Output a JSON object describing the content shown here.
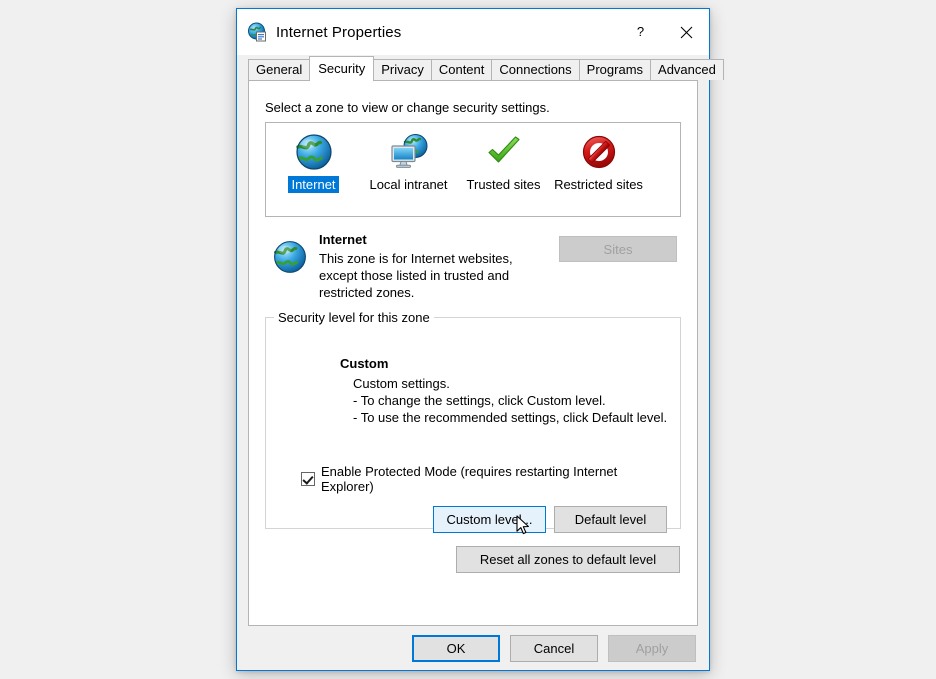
{
  "window": {
    "title": "Internet Properties",
    "icon": "internet-properties-icon",
    "help_button": "?",
    "close_button": "✕"
  },
  "tabs": [
    {
      "label": "General",
      "active": false
    },
    {
      "label": "Security",
      "active": true
    },
    {
      "label": "Privacy",
      "active": false
    },
    {
      "label": "Content",
      "active": false
    },
    {
      "label": "Connections",
      "active": false
    },
    {
      "label": "Programs",
      "active": false
    },
    {
      "label": "Advanced",
      "active": false
    }
  ],
  "security_tab": {
    "intro": "Select a zone to view or change security settings.",
    "zones": [
      {
        "label": "Internet",
        "icon": "globe-icon",
        "selected": true
      },
      {
        "label": "Local intranet",
        "icon": "monitor-globe-icon",
        "selected": false
      },
      {
        "label": "Trusted sites",
        "icon": "green-check-icon",
        "selected": false
      },
      {
        "label": "Restricted sites",
        "icon": "red-prohibition-icon",
        "selected": false
      }
    ],
    "zone_description": {
      "icon": "globe-icon",
      "title": "Internet",
      "line1": "This zone is for Internet websites,",
      "line2": "except those listed in trusted and",
      "line3": "restricted zones."
    },
    "sites_button": {
      "label": "Sites",
      "disabled": true
    },
    "security_level": {
      "legend": "Security level for this zone",
      "level_name": "Custom",
      "line1": "Custom settings.",
      "line2": "- To change the settings, click Custom level.",
      "line3": "- To use the recommended settings, click Default level.",
      "protected_mode": {
        "label": "Enable Protected Mode (requires restarting Internet Explorer)",
        "checked": true
      },
      "custom_level_button": {
        "label": "Custom level...",
        "state": "hover"
      },
      "default_level_button": {
        "label": "Default level",
        "state": "normal"
      }
    },
    "reset_button": {
      "label": "Reset all zones to default level"
    }
  },
  "command_buttons": {
    "ok": {
      "label": "OK",
      "state": "default"
    },
    "cancel": {
      "label": "Cancel",
      "state": "normal"
    },
    "apply": {
      "label": "Apply",
      "state": "disabled"
    }
  },
  "colors": {
    "accent": "#0078d7",
    "hover_fill": "#e5f1fb",
    "button_face": "#e1e1e1",
    "desktop": "#f0f0f0",
    "disabled_text": "#a0a0a0"
  }
}
